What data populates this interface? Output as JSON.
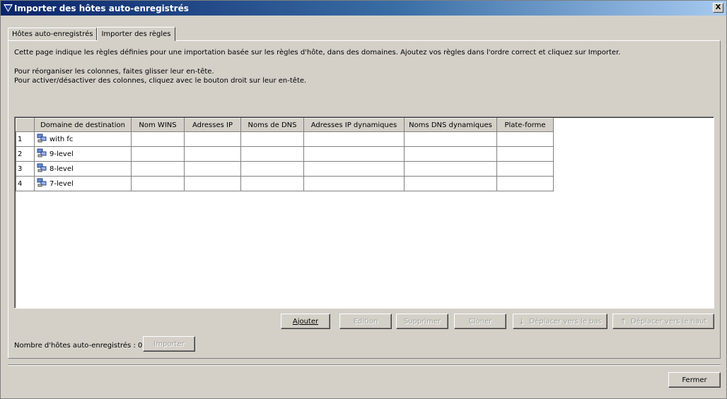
{
  "window": {
    "title": "Importer des hôtes auto-enregistrés",
    "close_label": "X"
  },
  "tabs": [
    {
      "label": "Hôtes auto-enregistrés",
      "active": false
    },
    {
      "label": "Importer des règles",
      "active": true
    }
  ],
  "description": {
    "line1": "Cette page indique les règles définies pour une importation basée sur les règles d'hôte, dans des domaines. Ajoutez vos règles dans l'ordre correct et cliquez sur Importer.",
    "line2": "Pour réorganiser les colonnes, faites glisser leur en-tête.",
    "line3": "Pour activer/désactiver des colonnes, cliquez avec le bouton droit sur leur en-tête."
  },
  "table": {
    "columns": [
      "",
      "Domaine de destination",
      "Nom WINS",
      "Adresses IP",
      "Noms de DNS",
      "Adresses IP dynamiques",
      "Noms DNS dynamiques",
      "Plate-forme"
    ],
    "rows": [
      {
        "num": "1",
        "domain": "with fc"
      },
      {
        "num": "2",
        "domain": "9-level"
      },
      {
        "num": "3",
        "domain": "8-level"
      },
      {
        "num": "4",
        "domain": "7-level"
      }
    ],
    "domain_icon": "network-domain-icon"
  },
  "buttons": {
    "add": "Ajouter",
    "edit": "Edition",
    "delete": "Supprimer",
    "clone": "Cloner",
    "move_down": "Déplacer vers le bas",
    "move_up": "Déplacer vers le haut",
    "import": "Importer",
    "close": "Fermer"
  },
  "status": {
    "count_label": "Nombre d'hôtes auto-enregistrés : 0"
  }
}
